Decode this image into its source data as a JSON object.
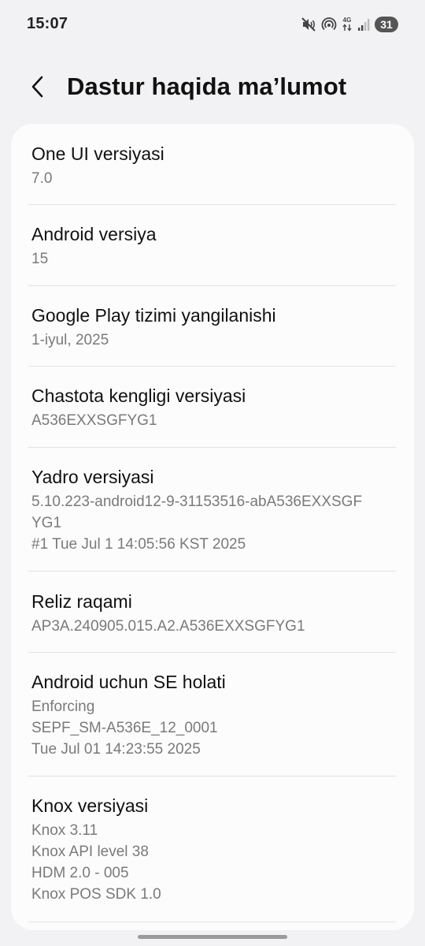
{
  "status_bar": {
    "time": "15:07",
    "network_label": "4G",
    "battery_level": "31",
    "icons": [
      "mute-vibrate-icon",
      "hotspot-icon",
      "mobile-data-icon",
      "signal-icon",
      "battery-icon"
    ]
  },
  "header": {
    "back_icon": "chevron-left-icon",
    "title": "Dastur haqida ma’lumot"
  },
  "items": [
    {
      "title": "One UI versiyasi",
      "lines": [
        "7.0"
      ]
    },
    {
      "title": "Android versiya",
      "lines": [
        "15"
      ]
    },
    {
      "title": "Google Play tizimi yangilanishi",
      "lines": [
        "1-iyul, 2025"
      ]
    },
    {
      "title": "Chastota kengligi versiyasi",
      "lines": [
        "A536EXXSGFYG1"
      ]
    },
    {
      "title": "Yadro versiyasi",
      "lines": [
        "5.10.223-android12-9-31153516-abA536EXXSGF",
        "YG1",
        "#1 Tue Jul 1 14:05:56 KST 2025"
      ]
    },
    {
      "title": "Reliz raqami",
      "lines": [
        "AP3A.240905.015.A2.A536EXXSGFYG1"
      ]
    },
    {
      "title": "Android uchun SE holati",
      "lines": [
        "Enforcing",
        "SEPF_SM-A536E_12_0001",
        "Tue Jul 01 14:23:55 2025"
      ]
    },
    {
      "title": "Knox versiyasi",
      "lines": [
        "Knox 3.11",
        "Knox API level 38",
        "HDM 2.0 - 005",
        "Knox POS SDK 1.0"
      ]
    }
  ],
  "colors": {
    "background": "#f2f2f4",
    "card": "#fcfcfc",
    "title_text": "#111111",
    "secondary_text": "#7a7a7a",
    "divider": "#e3e3e3"
  }
}
